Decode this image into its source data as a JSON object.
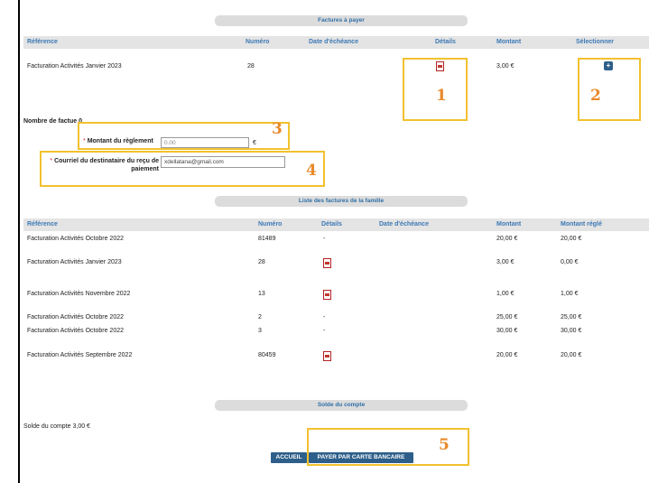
{
  "invoices_to_pay": {
    "title": "Factures à payer",
    "headers": [
      "Référence",
      "Numéro",
      "Date d'échéance",
      "Détails",
      "Montant",
      "Sélectionner"
    ],
    "rows": [
      {
        "reference": "Facturation Activités Janvier 2023",
        "numero": "28",
        "date": "",
        "details_icon": "pdf-icon",
        "montant": "3,00 €",
        "select_icon": "plus-icon"
      }
    ]
  },
  "form": {
    "invoice_count_label": "Nombre de factu",
    "invoice_count_value": "e 0",
    "payment_amount_label": "Montant du règlement",
    "payment_amount_value": "0.00",
    "currency": "€",
    "email_label_line1": "Courriel du destinataire du reçu de",
    "email_label_line2": "paiement",
    "email_value": "xdellatana@gmail.com",
    "required_mark": "*"
  },
  "family_invoices": {
    "title": "Liste des factures de la famille",
    "headers": [
      "Référence",
      "Numéro",
      "Détails",
      "Date d'échéance",
      "Montant",
      "Montant réglé"
    ],
    "rows": [
      {
        "reference": "Facturation Activités Octobre 2022",
        "numero": "81489",
        "details": "-",
        "montant": "20,00 €",
        "regle": "20,00 €"
      },
      {
        "reference": "Facturation Activités Janvier 2023",
        "numero": "28",
        "details_icon": "pdf-icon",
        "montant": "3,00 €",
        "regle": "0,00 €"
      },
      {
        "reference": "Facturation Activités Novembre 2022",
        "numero": "13",
        "details_icon": "pdf-icon",
        "montant": "1,00 €",
        "regle": "1,00 €"
      },
      {
        "reference": "Facturation Activités Octobre 2022",
        "numero": "2",
        "details": "-",
        "montant": "25,00 €",
        "regle": "25,00 €"
      },
      {
        "reference": "Facturation Activités Octobre 2022",
        "numero": "3",
        "details": "-",
        "montant": "30,00 €",
        "regle": "30,00 €"
      },
      {
        "reference": "Facturation Activités Septembre 2022",
        "numero": "80459",
        "details_icon": "pdf-icon",
        "montant": "20,00 €",
        "regle": "20,00 €"
      }
    ]
  },
  "balance": {
    "title": "Solde du compte",
    "text": "Solde du compte 3,00 €"
  },
  "buttons": {
    "home": "ACCUEIL",
    "pay_card": "PAYER PAR CARTE BANCAIRE"
  },
  "annotations": [
    "1",
    "2",
    "3",
    "4",
    "5"
  ],
  "colors": {
    "accent": "#2e5f8a",
    "header_text": "#3d79b5",
    "annotation_box": "#f2c12e",
    "annotation_number": "#e8892a"
  }
}
